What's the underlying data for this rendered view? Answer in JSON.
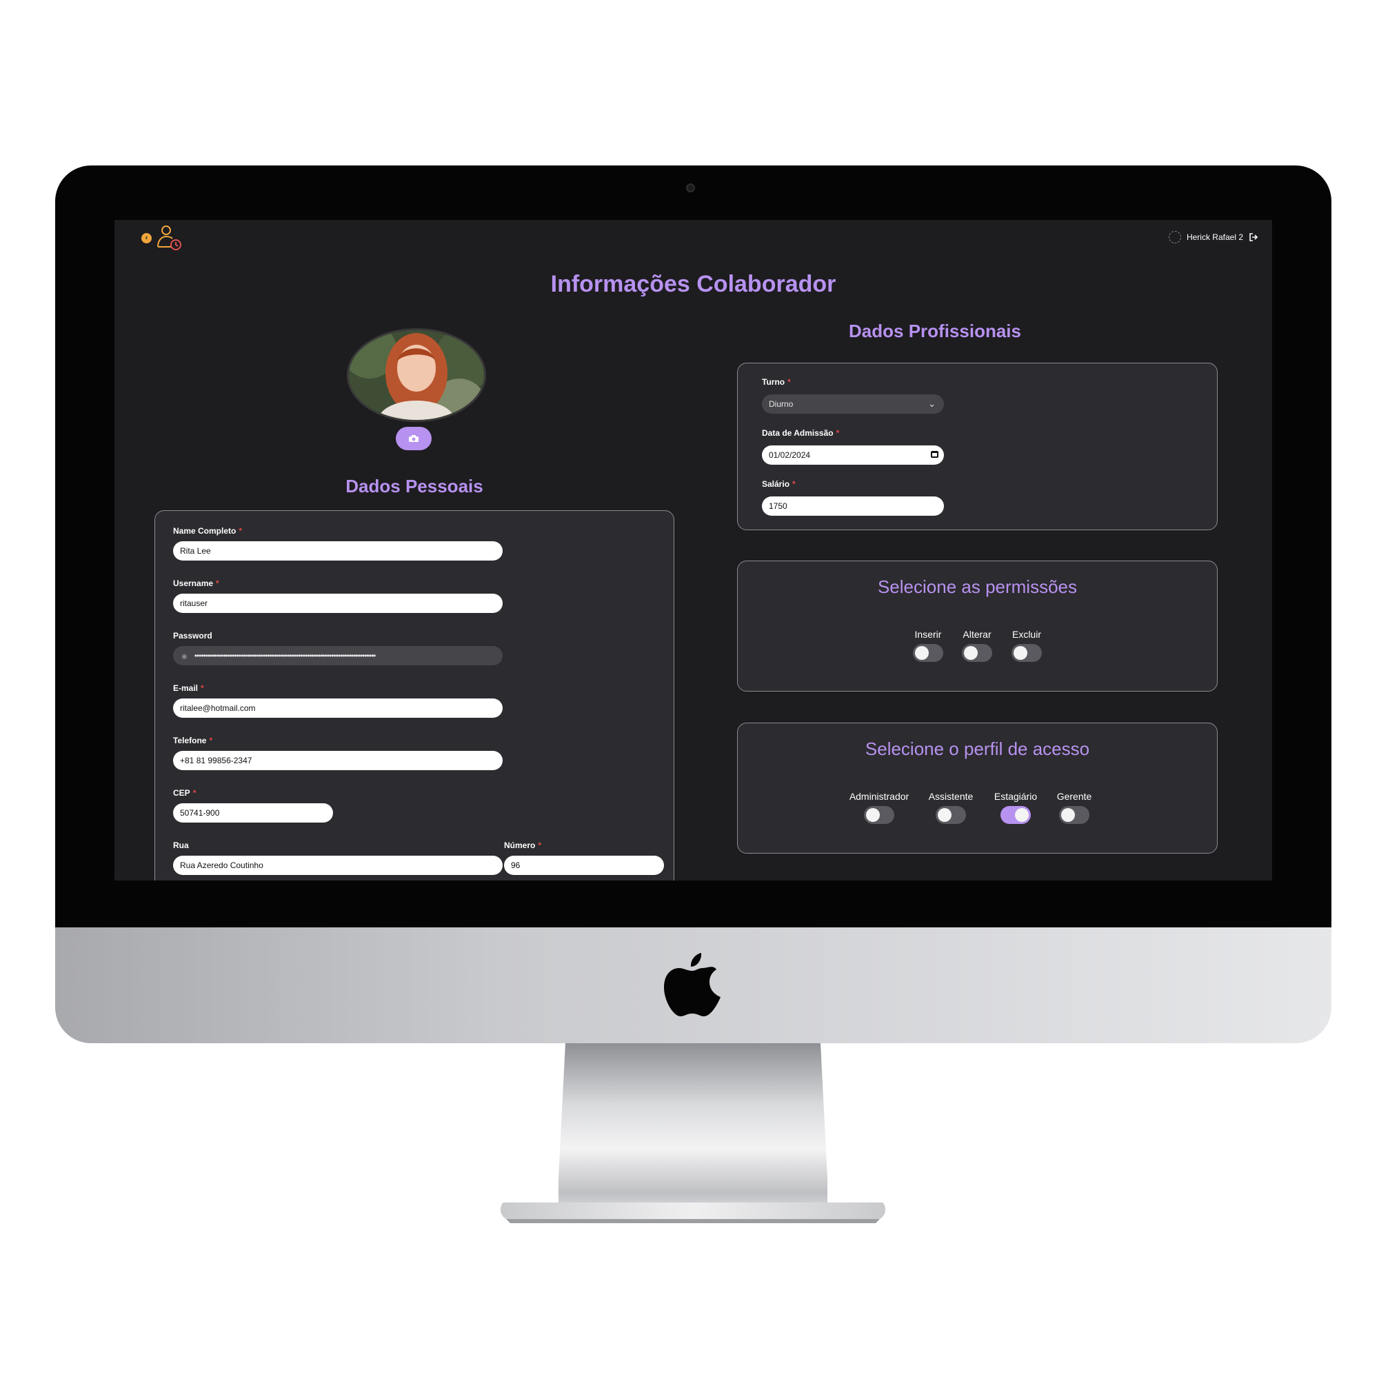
{
  "header": {
    "user_name": "Herick Rafael 2"
  },
  "page": {
    "title": "Informações Colaborador"
  },
  "personal": {
    "title": "Dados Pessoais",
    "fields": {
      "full_name": {
        "label": "Name Completo",
        "value": "Rita Lee"
      },
      "username": {
        "label": "Username",
        "value": "ritauser"
      },
      "password": {
        "label": "Password",
        "value": "••••••••••••••••••••••••••••••••••••••••••••••••••••••••••••••••••••••••••••••••••"
      },
      "email": {
        "label": "E-mail",
        "value": "ritalee@hotmail.com"
      },
      "phone": {
        "label": "Telefone",
        "value": "+81 81 99856-2347"
      },
      "cep": {
        "label": "CEP",
        "value": "50741-900"
      },
      "street": {
        "label": "Rua",
        "value": "Rua Azeredo Coutinho"
      },
      "number": {
        "label": "Número",
        "value": "96"
      }
    },
    "required_mark": "*"
  },
  "professional": {
    "title": "Dados Profissionais",
    "fields": {
      "shift": {
        "label": "Turno",
        "value": "Diurno"
      },
      "admission_date": {
        "label": "Data de Admissão",
        "value": "01/02/2024"
      },
      "salary": {
        "label": "Salário",
        "value": "1750"
      }
    }
  },
  "permissions": {
    "title": "Selecione as permissões",
    "items": [
      {
        "label": "Inserir",
        "on": false
      },
      {
        "label": "Alterar",
        "on": false
      },
      {
        "label": "Excluir",
        "on": false
      }
    ]
  },
  "profiles": {
    "title": "Selecione o perfil de acesso",
    "items": [
      {
        "label": "Administrador",
        "on": false
      },
      {
        "label": "Assistente",
        "on": false
      },
      {
        "label": "Estagiário",
        "on": true
      },
      {
        "label": "Gerente",
        "on": false
      }
    ]
  },
  "icons": {
    "back": "chevron-left-icon",
    "app": "user-clock-icon",
    "camera": "camera-icon",
    "logout": "logout-icon",
    "calendar": "calendar-icon",
    "eye": "eye-icon",
    "dropdown": "chevron-down-icon",
    "brand": "apple-logo"
  },
  "colors": {
    "accent": "#b792f0",
    "screen_bg": "#1d1c1f",
    "card_bg": "#2c2b2f",
    "required": "#e04848",
    "back_icon": "#f0a53c"
  }
}
